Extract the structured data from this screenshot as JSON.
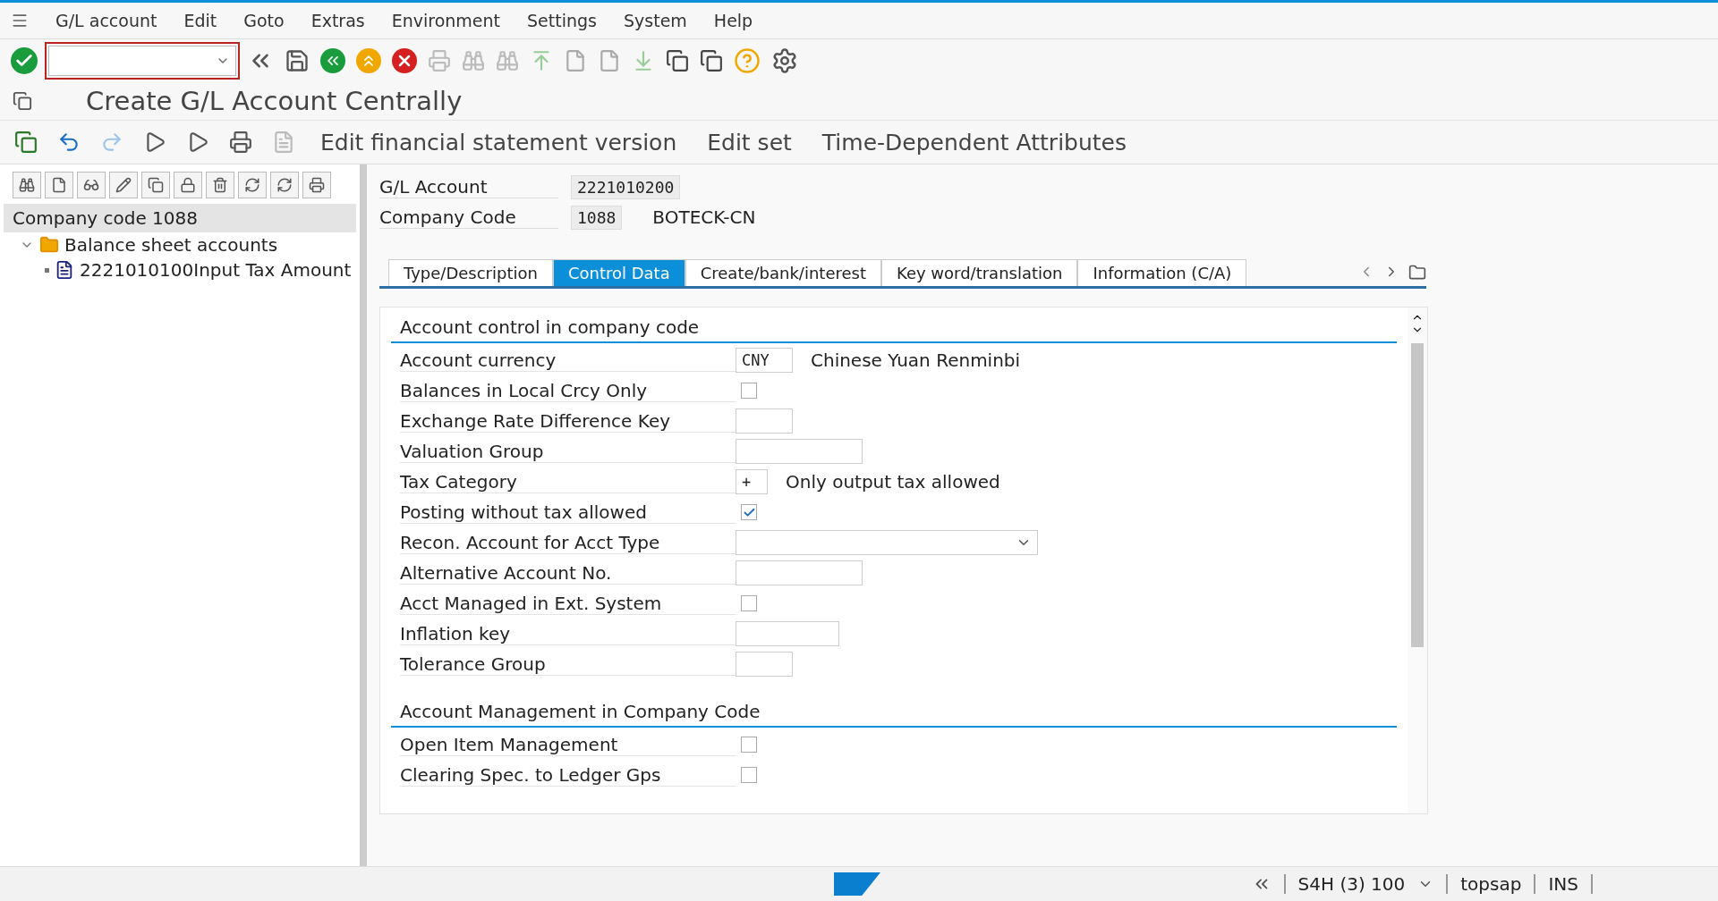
{
  "menu": [
    "G/L account",
    "Edit",
    "Goto",
    "Extras",
    "Environment",
    "Settings",
    "System",
    "Help"
  ],
  "title": "Create G/L Account Centrally",
  "app_toolbar": [
    "Edit financial statement version",
    "Edit set",
    "Time-Dependent Attributes"
  ],
  "tree": {
    "header": "Company code 1088",
    "items": [
      {
        "label": "Balance sheet accounts",
        "kind": "folder",
        "expanded": true,
        "children": [
          {
            "label": "2221010100Input Tax Amount",
            "kind": "document"
          }
        ]
      }
    ]
  },
  "header_fields": [
    {
      "label": "G/L Account",
      "value": "2221010200"
    },
    {
      "label": "Company Code",
      "value": "1088",
      "description": "BOTECK-CN"
    }
  ],
  "tabs": [
    {
      "label": "Type/Description",
      "selected": false
    },
    {
      "label": "Control Data",
      "selected": true
    },
    {
      "label": "Create/bank/interest",
      "selected": false
    },
    {
      "label": "Key word/translation",
      "selected": false
    },
    {
      "label": "Information (C/A)",
      "selected": false
    }
  ],
  "sections": [
    {
      "title": "Account control in company code",
      "rows": [
        {
          "label": "Account currency",
          "kind": "short",
          "value": "CNY",
          "description": "Chinese Yuan Renminbi"
        },
        {
          "label": "Balances in Local Crcy Only",
          "kind": "checkbox",
          "checked": false
        },
        {
          "label": "Exchange Rate Difference Key",
          "kind": "short"
        },
        {
          "label": "Valuation Group",
          "kind": "long"
        },
        {
          "label": "Tax Category",
          "kind": "tiny",
          "value": "+",
          "description": "Only output tax allowed"
        },
        {
          "label": "Posting without tax allowed",
          "kind": "checkbox",
          "checked": true
        },
        {
          "label": "Recon. Account for Acct Type",
          "kind": "select"
        },
        {
          "label": "Alternative Account No.",
          "kind": "long"
        },
        {
          "label": "Acct Managed in Ext. System",
          "kind": "checkbox",
          "checked": false
        },
        {
          "label": "Inflation key",
          "kind": "medium"
        },
        {
          "label": "Tolerance Group",
          "kind": "short"
        }
      ]
    },
    {
      "title": "Account Management in Company Code",
      "rows": [
        {
          "label": "Open Item Management",
          "kind": "checkbox",
          "checked": false
        },
        {
          "label": "Clearing Spec. to Ledger Gps",
          "kind": "checkbox",
          "checked": false
        }
      ]
    }
  ],
  "status_bar": {
    "system": "S4H (3) 100",
    "user": "topsap",
    "mode": "INS"
  }
}
